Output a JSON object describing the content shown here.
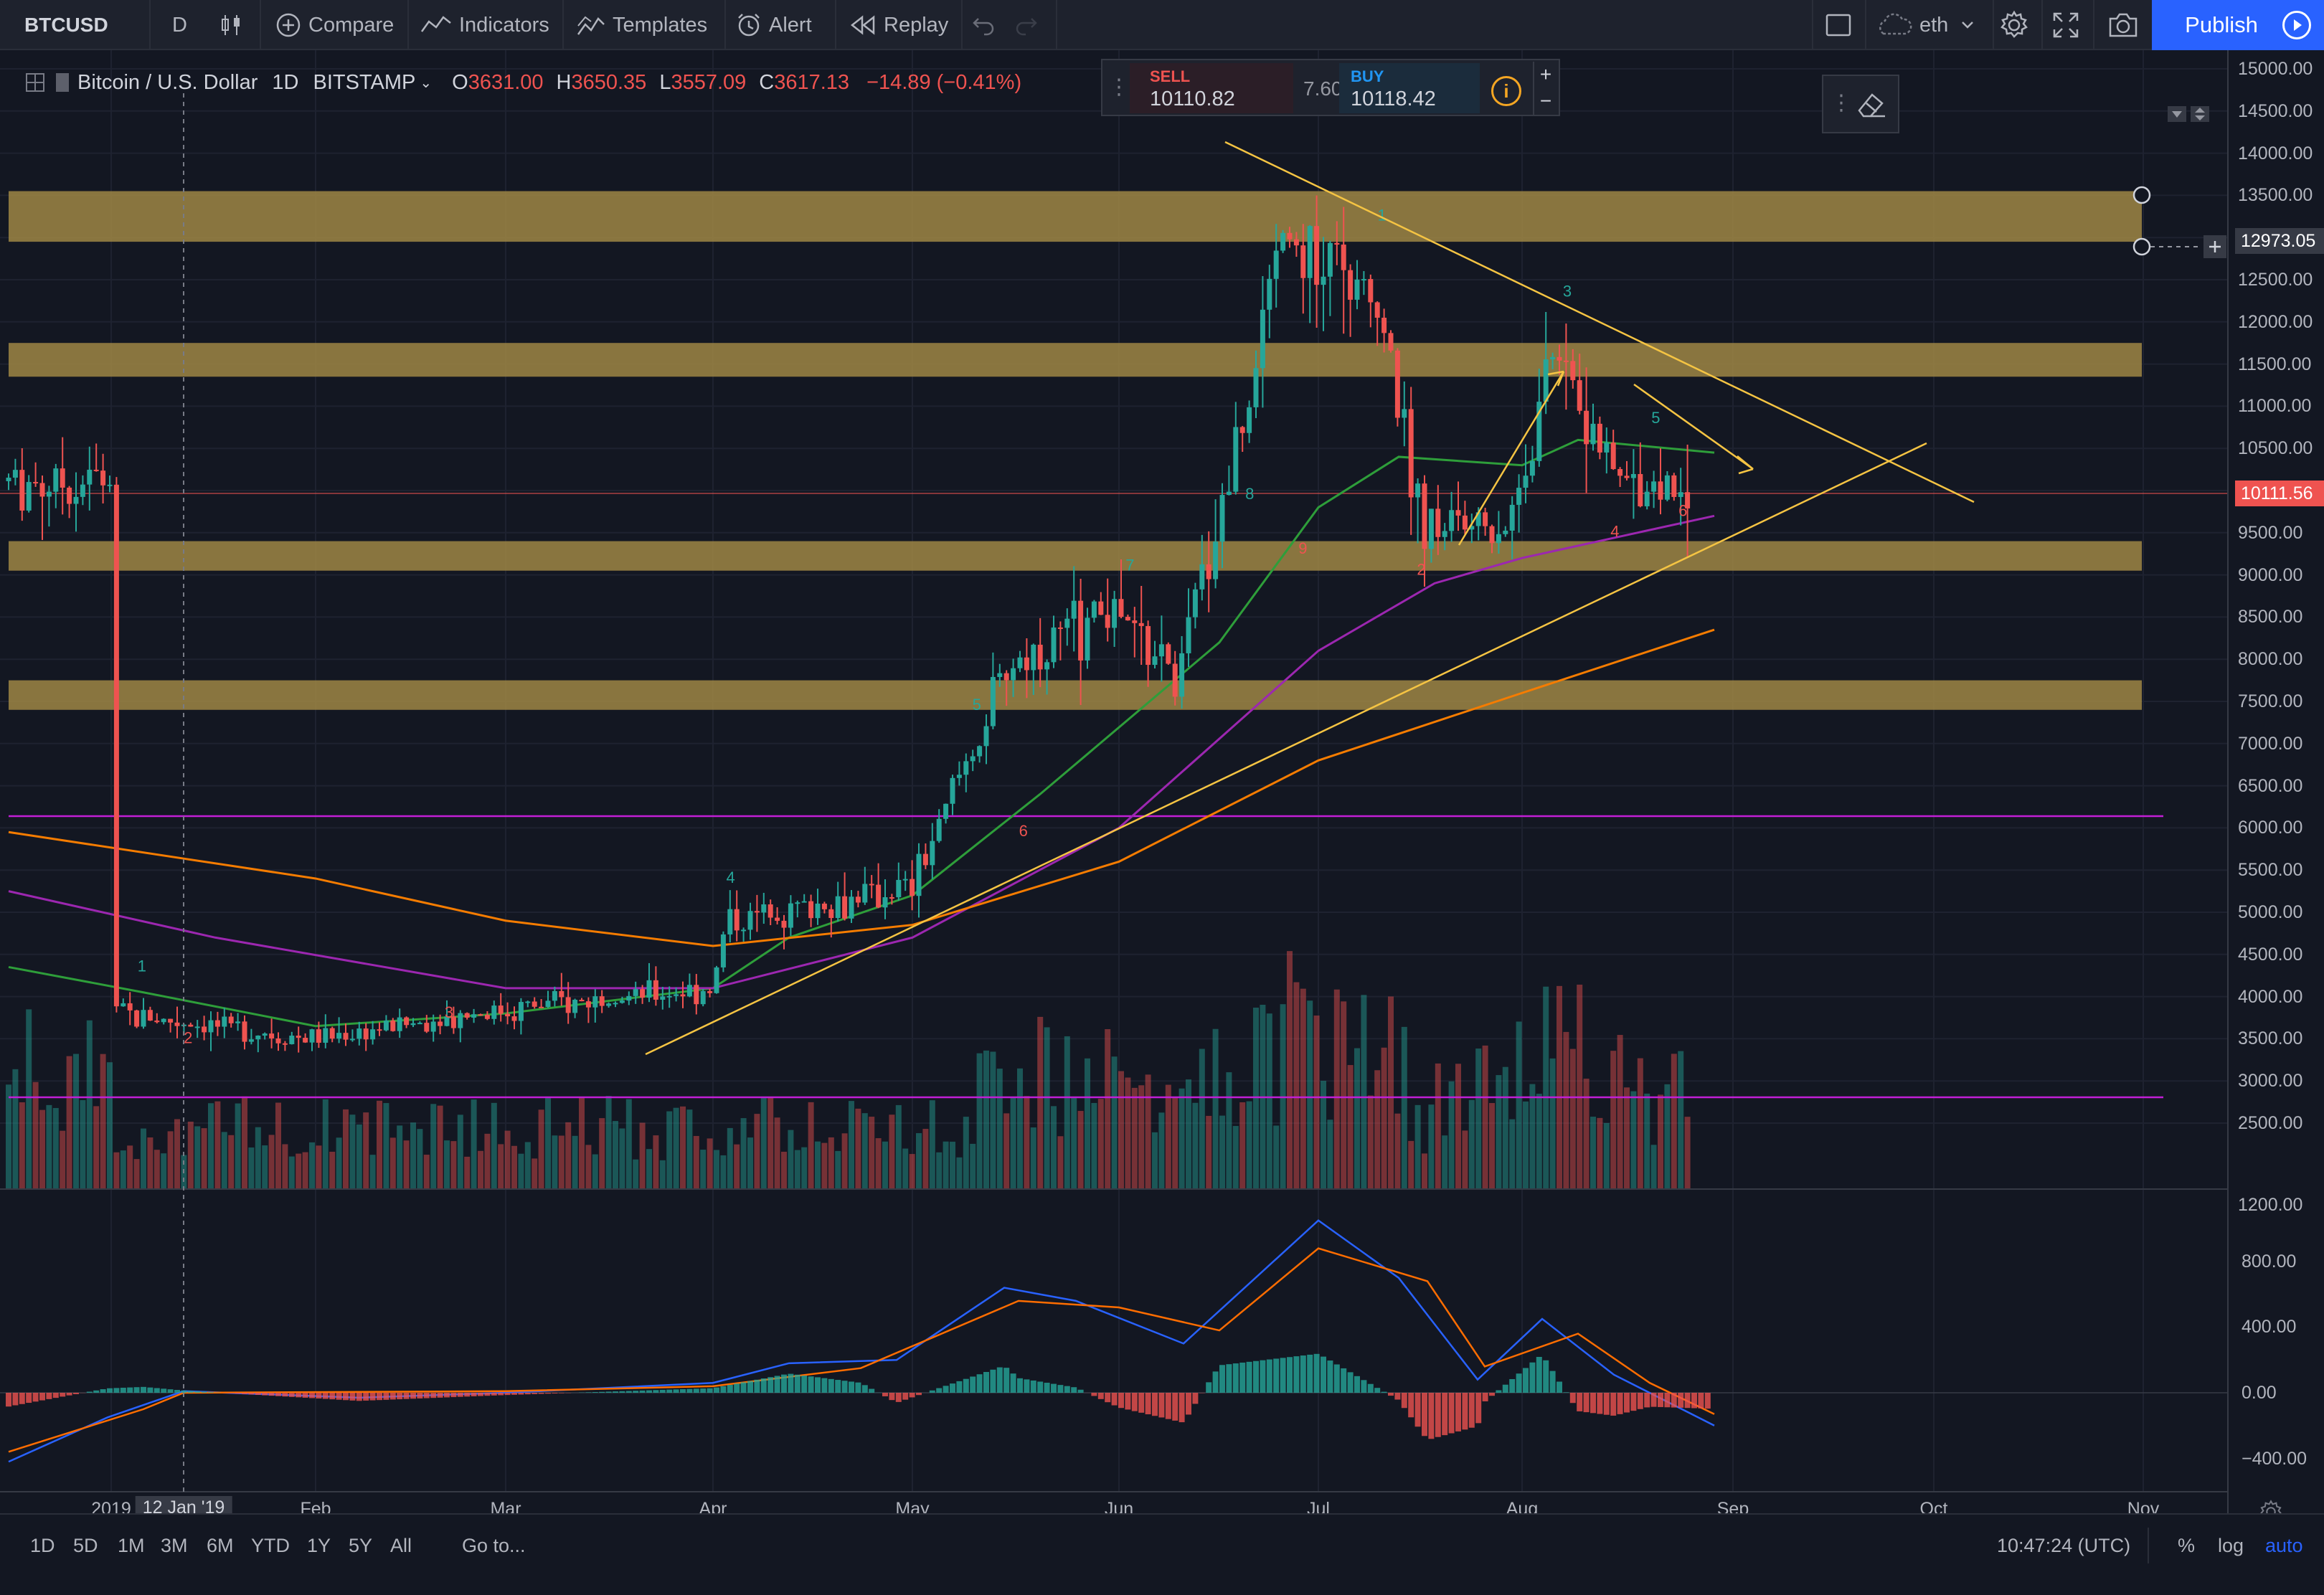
{
  "toolbar": {
    "symbol": "BTCUSD",
    "interval": "D",
    "compare": "Compare",
    "indicators": "Indicators",
    "templates": "Templates",
    "alert": "Alert",
    "replay": "Replay",
    "layout_name": "eth",
    "publish": "Publish"
  },
  "legend": {
    "title": "Bitcoin / U.S. Dollar",
    "interval": "1D",
    "exchange": "BITSTAMP",
    "o_label": "O",
    "o_value": "3631.00",
    "h_label": "H",
    "h_value": "3650.35",
    "l_label": "L",
    "l_value": "3557.09",
    "c_label": "C",
    "c_value": "3617.13",
    "change": "−14.89 (−0.41%)"
  },
  "trade_panel": {
    "sell_label": "SELL",
    "sell_price": "10110.82",
    "spread": "7.60",
    "buy_label": "BUY",
    "buy_price": "10118.42",
    "plus": "+",
    "minus": "−"
  },
  "price_axis": [
    "15000.00",
    "14500.00",
    "14000.00",
    "13500.00",
    "12500.00",
    "12000.00",
    "11500.00",
    "11000.00",
    "10500.00",
    "9500.00",
    "9000.00",
    "8500.00",
    "8000.00",
    "7500.00",
    "7000.00",
    "6500.00",
    "6000.00",
    "5500.00",
    "5000.00",
    "4500.00",
    "4000.00",
    "3500.00",
    "3000.00",
    "2500.00",
    "1200.00"
  ],
  "price_tags": {
    "cursor_price": "12973.05",
    "last_price": "10111.56"
  },
  "macd_axis": [
    "800.00",
    "400.00",
    "0.00",
    "−400.00"
  ],
  "time_axis": [
    "2019",
    "12 Jan '19",
    "Feb",
    "Mar",
    "Apr",
    "May",
    "Jun",
    "Jul",
    "Aug",
    "Sep",
    "Oct",
    "Nov"
  ],
  "bottom": {
    "ranges": [
      "1D",
      "5D",
      "1M",
      "3M",
      "6M",
      "YTD",
      "1Y",
      "5Y",
      "All"
    ],
    "goto": "Go to...",
    "clock": "10:47:24 (UTC)",
    "percent": "%",
    "log": "log",
    "auto": "auto"
  },
  "colors": {
    "background": "#131722",
    "zone": "#a38a45",
    "bull": "#26a69a",
    "bear": "#ef5350",
    "trendline": "#f5c443",
    "ma_green": "#2e9e3a",
    "ma_purple": "#9c27b0",
    "ma_orange": "#f57c00",
    "hline": "#c21fd6",
    "accent": "#2962ff"
  },
  "chart_data": {
    "type": "candlestick",
    "title": "Bitcoin / U.S. Dollar",
    "x": [
      "2019-01",
      "2019-02",
      "2019-03",
      "2019-04",
      "2019-05",
      "2019-06",
      "2019-07",
      "2019-08",
      "2019-09",
      "2019-10",
      "2019-11"
    ],
    "ylim": [
      1200,
      15200
    ],
    "price_points": [
      {
        "t": "2019-01-01",
        "p": 3800
      },
      {
        "t": "2019-02-01",
        "p": 3500
      },
      {
        "t": "2019-03-01",
        "p": 3850
      },
      {
        "t": "2019-04-01",
        "p": 4100
      },
      {
        "t": "2019-04-03",
        "p": 4900
      },
      {
        "t": "2019-05-01",
        "p": 5300
      },
      {
        "t": "2019-05-15",
        "p": 7900
      },
      {
        "t": "2019-05-30",
        "p": 8600
      },
      {
        "t": "2019-06-10",
        "p": 7800
      },
      {
        "t": "2019-06-26",
        "p": 13000
      },
      {
        "t": "2019-07-10",
        "p": 12300
      },
      {
        "t": "2019-07-17",
        "p": 9600
      },
      {
        "t": "2019-07-30",
        "p": 9600
      },
      {
        "t": "2019-08-06",
        "p": 11800
      },
      {
        "t": "2019-08-15",
        "p": 10100
      },
      {
        "t": "2019-08-26",
        "p": 10111
      }
    ],
    "support_resistance_zones": [
      [
        12950,
        13550
      ],
      [
        11350,
        11750
      ],
      [
        9050,
        9400
      ],
      [
        7400,
        7750
      ]
    ],
    "horizontal_lines": [
      6400,
      3150
    ],
    "macd": {
      "ylim": [
        -450,
        1250
      ]
    }
  }
}
